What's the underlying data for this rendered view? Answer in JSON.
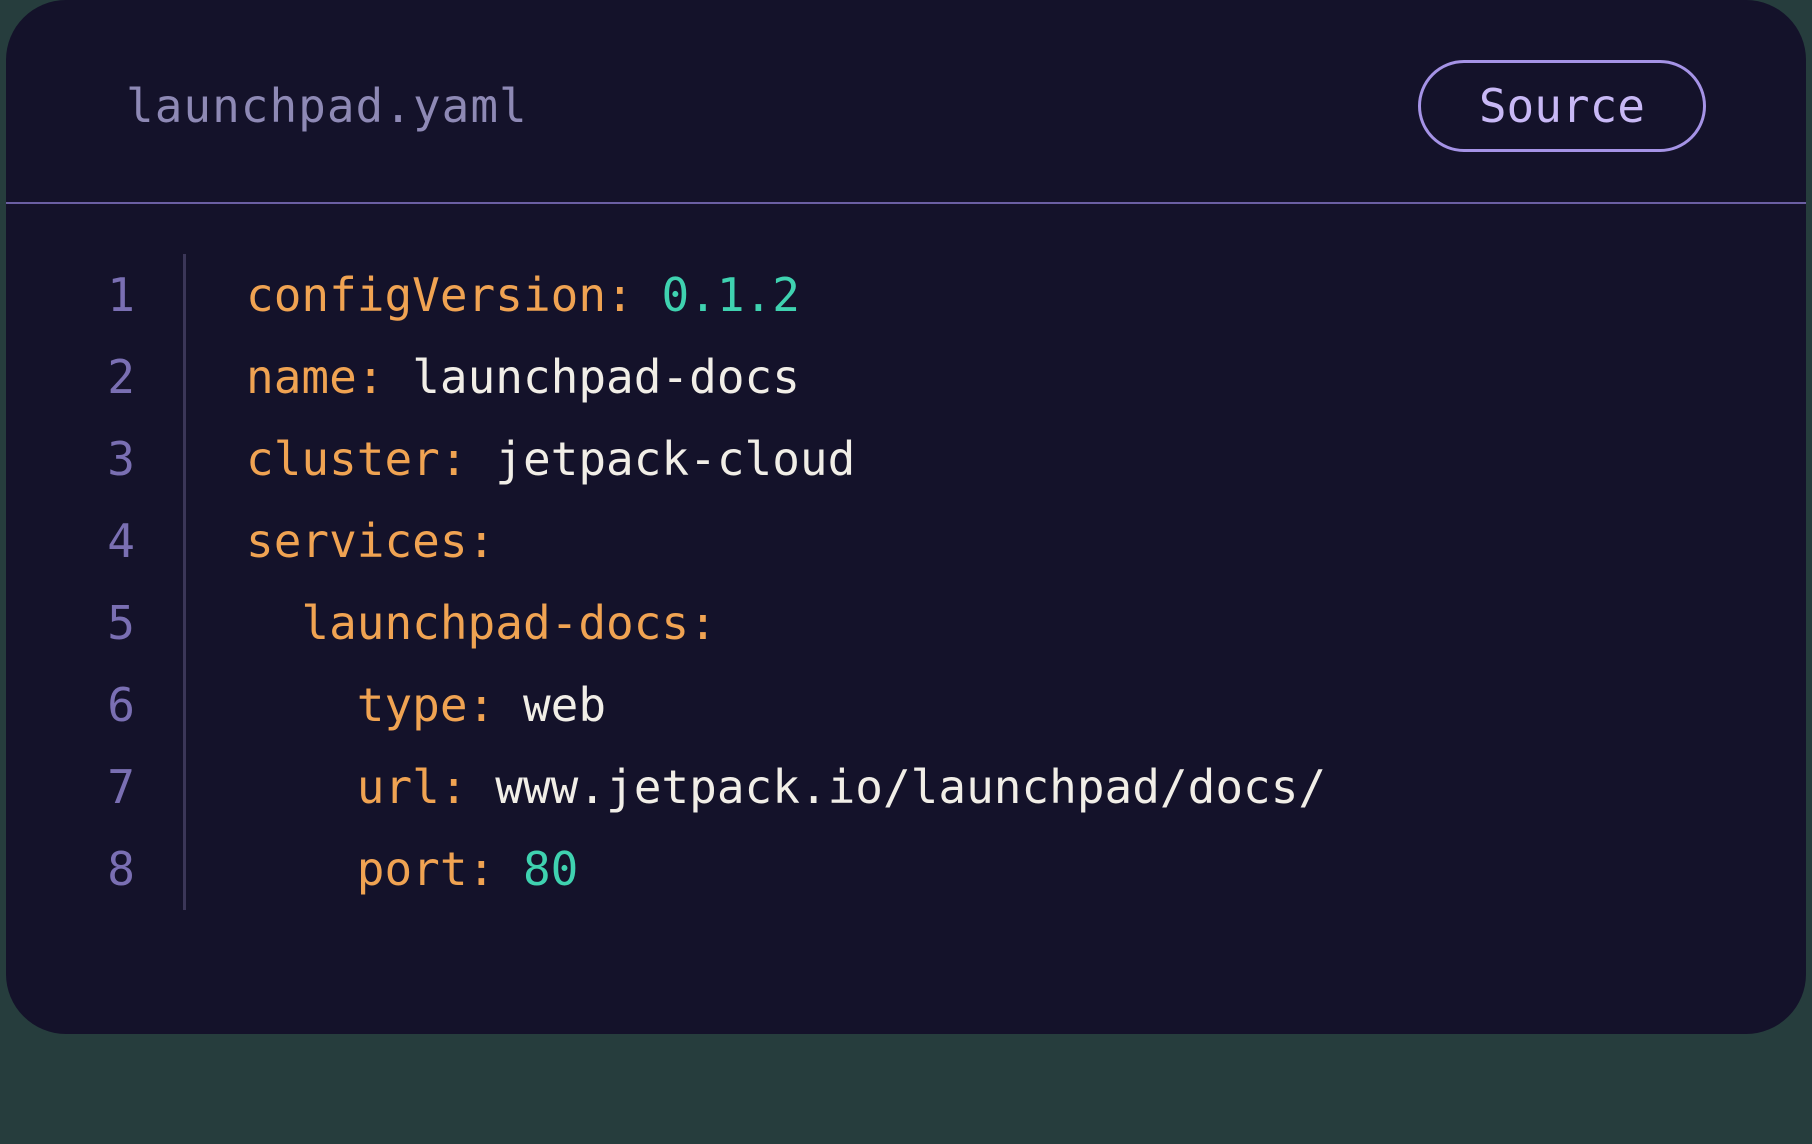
{
  "header": {
    "filename": "launchpad.yaml",
    "source_label": "Source"
  },
  "lineNumbers": [
    "1",
    "2",
    "3",
    "4",
    "5",
    "6",
    "7",
    "8"
  ],
  "code": {
    "l1_key": "configVersion:",
    "l1_val": "0.1.2",
    "l2_key": "name:",
    "l2_val": "launchpad-docs",
    "l3_key": "cluster:",
    "l3_val": "jetpack-cloud",
    "l4_key": "services:",
    "l5_indent": "  ",
    "l5_key": "launchpad-docs:",
    "l6_indent": "    ",
    "l6_key": "type:",
    "l6_val": "web",
    "l7_indent": "    ",
    "l7_key": "url:",
    "l7_val": "www.jetpack.io/launchpad/docs/",
    "l8_indent": "    ",
    "l8_key": "port:",
    "l8_val": "80"
  }
}
